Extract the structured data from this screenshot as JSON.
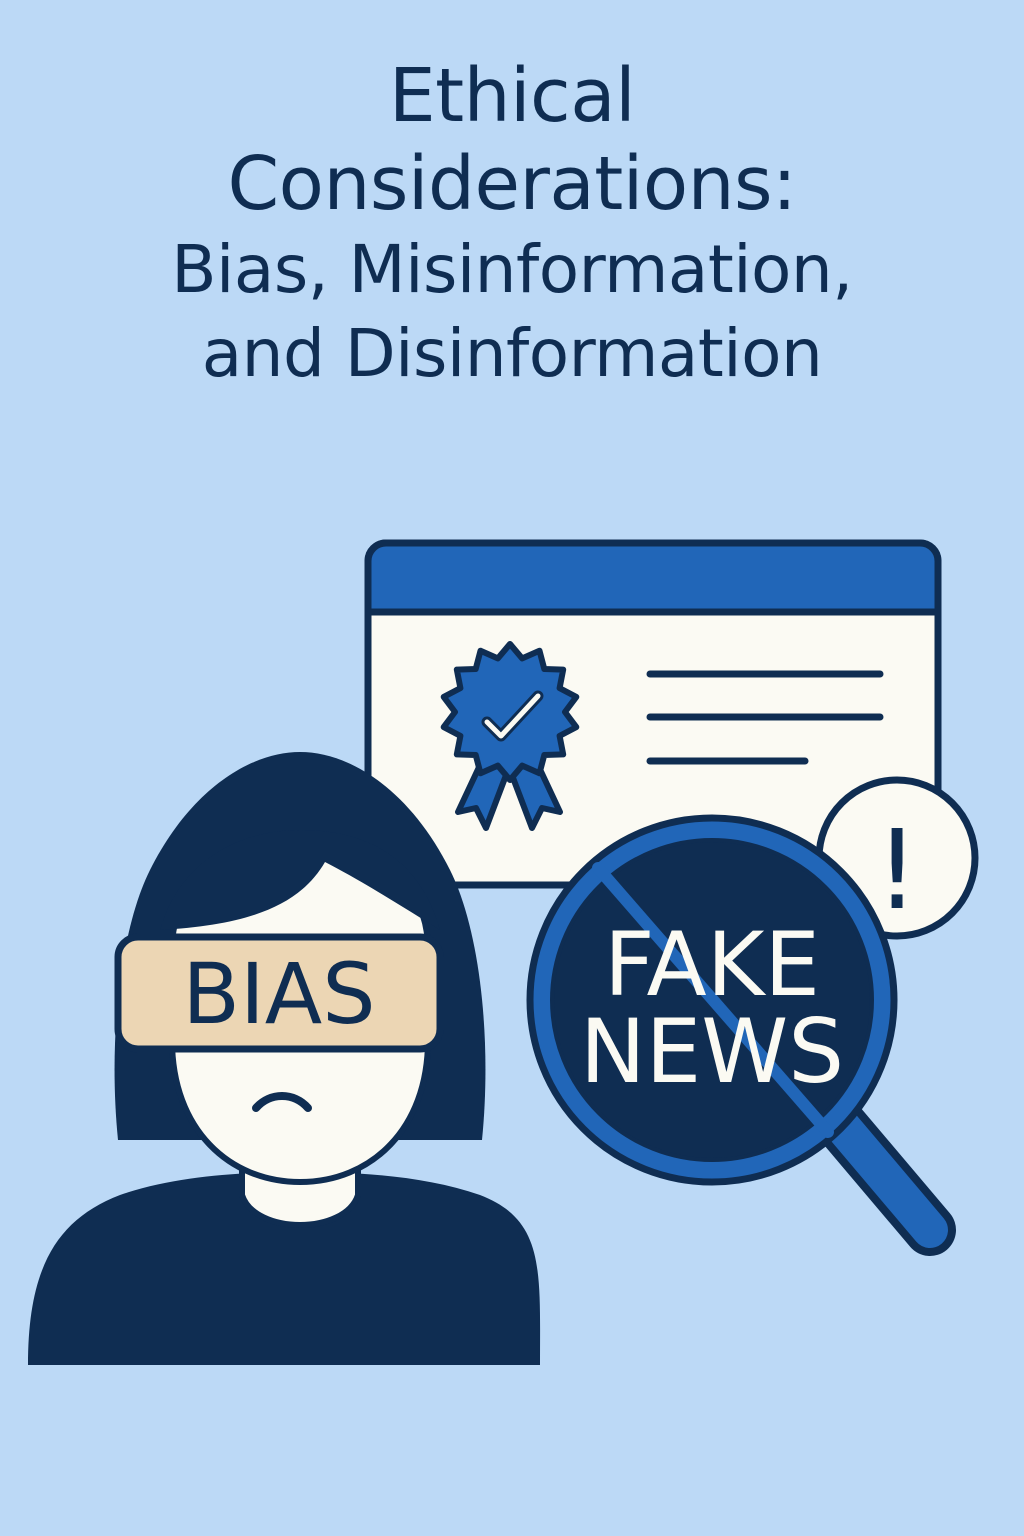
{
  "poster": {
    "title_lines": [
      "Ethical",
      "Considerations:",
      "Bias, Misinformation,",
      "and Disinformation"
    ]
  },
  "illustration": {
    "blindfold_label": "BIAS",
    "magnifier_label_lines": [
      "FAKE",
      "NEWS"
    ],
    "alert_symbol": "!",
    "colors": {
      "background": "#bcd9f6",
      "navy": "#0f2d52",
      "blue": "#2166b8",
      "paper": "#fbfaf3",
      "blindfold": "#ecd6b4"
    }
  }
}
